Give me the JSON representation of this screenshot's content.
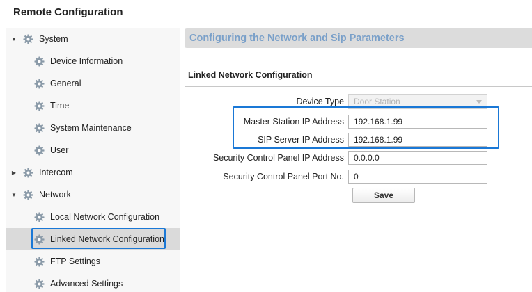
{
  "app": {
    "title": "Remote Configuration"
  },
  "sidebar": {
    "items": [
      {
        "label": "System",
        "level": 0,
        "expander": "expanded"
      },
      {
        "label": "Device Information",
        "level": 1
      },
      {
        "label": "General",
        "level": 1
      },
      {
        "label": "Time",
        "level": 1
      },
      {
        "label": "System Maintenance",
        "level": 1
      },
      {
        "label": "User",
        "level": 1
      },
      {
        "label": "Intercom",
        "level": 0,
        "expander": "collapsed"
      },
      {
        "label": "Network",
        "level": 0,
        "expander": "expanded"
      },
      {
        "label": "Local Network Configuration",
        "level": 1
      },
      {
        "label": "Linked Network Configuration",
        "level": 1,
        "selected": true
      },
      {
        "label": "FTP Settings",
        "level": 1
      },
      {
        "label": "Advanced Settings",
        "level": 1
      }
    ],
    "icons": {
      "node": "gear-icon",
      "expanded": "triangle-down-icon",
      "collapsed": "triangle-right-icon"
    }
  },
  "main": {
    "header_title": "Configuring the Network and Sip Parameters",
    "section_title": "Linked Network Configuration",
    "fields": {
      "device_type": {
        "label": "Device Type",
        "value": "Door Station"
      },
      "master_ip": {
        "label": "Master Station IP Address",
        "value": "192.168.1.99"
      },
      "sip_ip": {
        "label": "SIP Server IP Address",
        "value": "192.168.1.99"
      },
      "security_ip": {
        "label": "Security Control Panel IP Address",
        "value": "0.0.0.0"
      },
      "security_port": {
        "label": "Security Control Panel Port No.",
        "value": "0"
      }
    },
    "save_label": "Save"
  },
  "colors": {
    "highlight": "#1a78d6",
    "header_text": "#7aa0c9",
    "header_bg": "#dcdcdc",
    "sidebar_bg": "#f7f7f7",
    "selected_bg": "#dadada",
    "gear_fill": "#8a9aa8"
  }
}
